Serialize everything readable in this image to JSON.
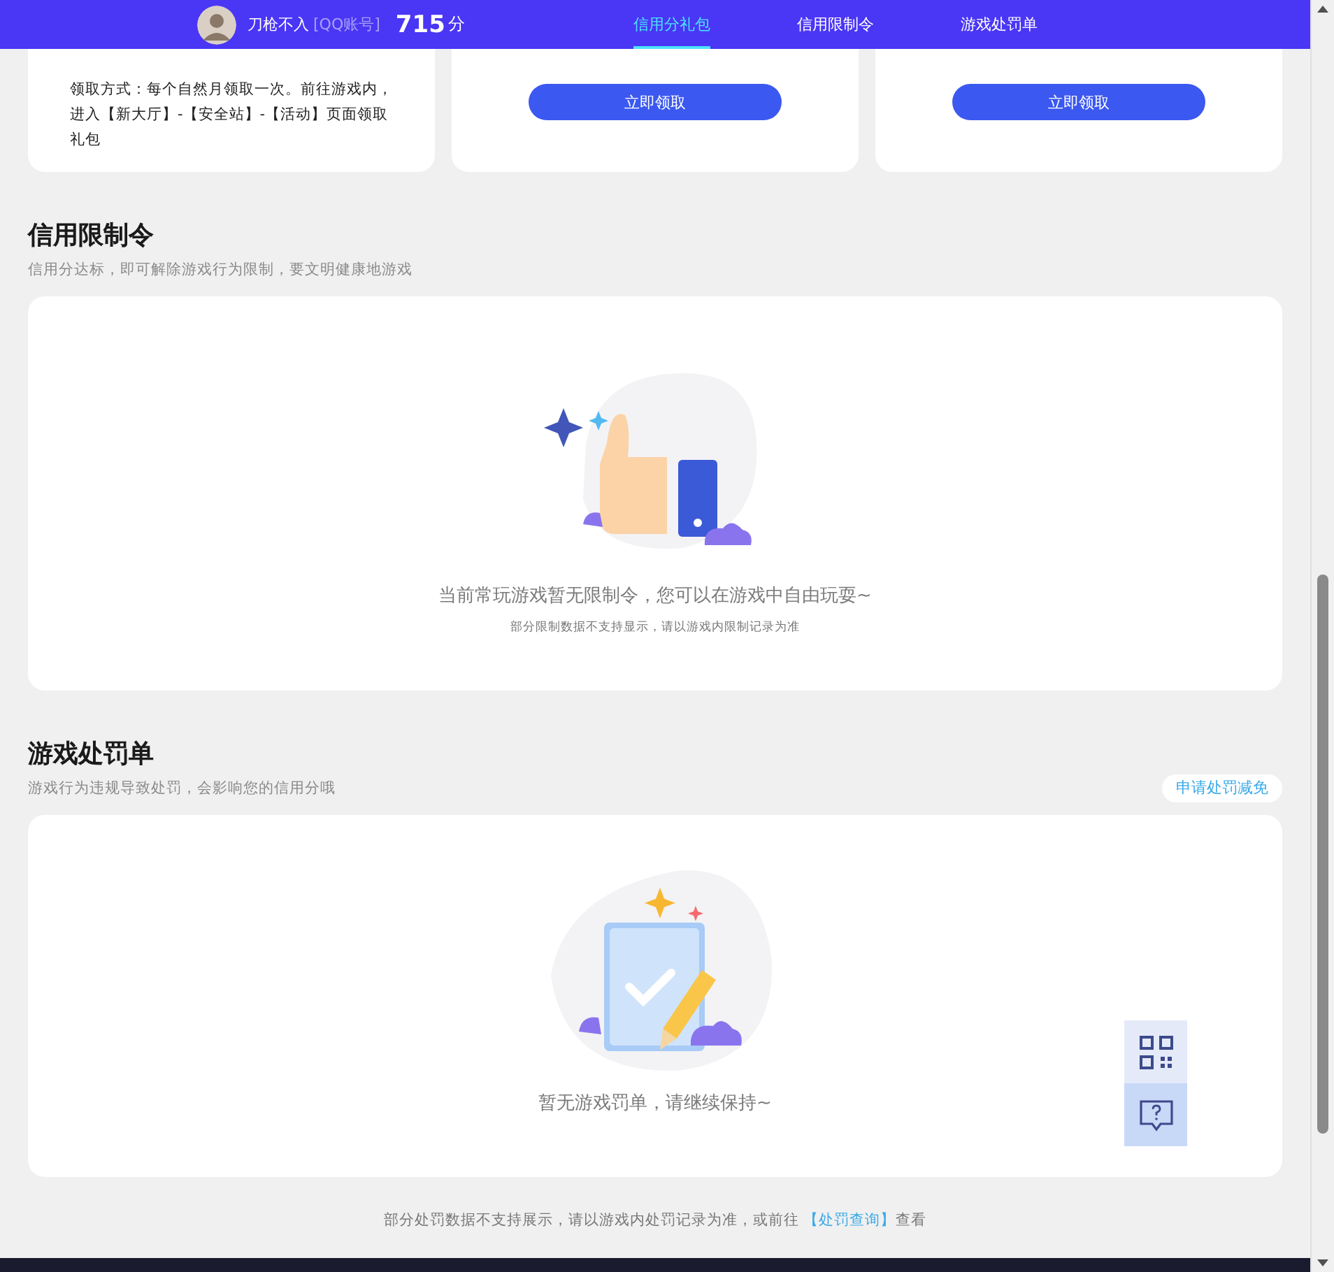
{
  "header": {
    "user_name": "刀枪不入",
    "account_tag": "[QQ账号]",
    "score": "715",
    "score_unit": "分",
    "tabs": [
      {
        "label": "信用分礼包",
        "selected": true
      },
      {
        "label": "信用限制令",
        "selected": false
      },
      {
        "label": "游戏处罚单",
        "selected": false
      }
    ]
  },
  "gift_cards": [
    {
      "kind": "text",
      "text": "领取方式：每个自然月领取一次。前往游戏内，进入【新大厅】-【安全站】-【活动】页面领取礼包"
    },
    {
      "kind": "button",
      "button": "立即领取"
    },
    {
      "kind": "button",
      "button": "立即领取"
    }
  ],
  "sections": [
    {
      "kind": "restriction",
      "title": "信用限制令",
      "subtitle": "信用分达标，即可解除游戏行为限制，要文明健康地游戏",
      "message": "当前常玩游戏暂无限制令，您可以在游戏中自由玩耍~",
      "note": "部分限制数据不支持显示，请以游戏内限制记录为准"
    },
    {
      "kind": "penalty",
      "title": "游戏处罚单",
      "subtitle": "游戏行为违规导致处罚，会影响您的信用分哦",
      "action": "申请处罚减免",
      "message": "暂无游戏罚单，请继续保持~"
    }
  ],
  "footer": {
    "text": "部分处罚数据不支持展示，请以游戏内处罚记录为准，或前往",
    "link": "【处罚查询】",
    "suffix": "查看"
  }
}
